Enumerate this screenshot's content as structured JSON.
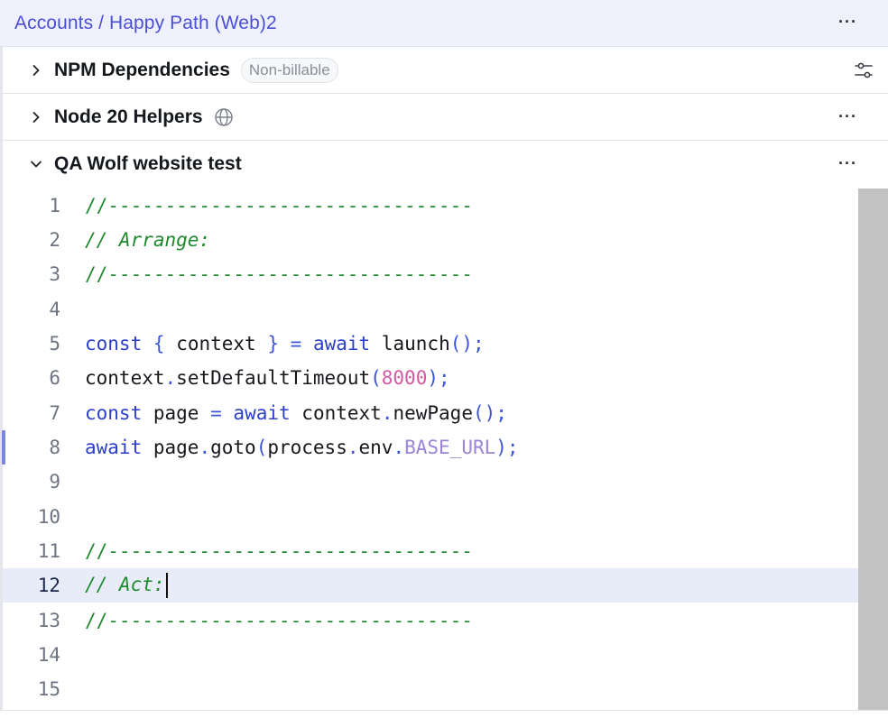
{
  "header": {
    "breadcrumb": "Accounts / Happy Path (Web)2",
    "more": "···"
  },
  "sections": [
    {
      "title": "NPM Dependencies",
      "badge": "Non-billable",
      "expanded": false,
      "icon": "filter-icon"
    },
    {
      "title": "Node 20 Helpers",
      "expanded": false,
      "icon": "globe-icon",
      "more": "···"
    },
    {
      "title": "QA Wolf website test",
      "expanded": true,
      "more": "···"
    }
  ],
  "editor": {
    "active_line": 12,
    "lines": [
      {
        "n": "1",
        "text": "//--------------------------------"
      },
      {
        "n": "2",
        "text": "// Arrange:"
      },
      {
        "n": "3",
        "text": "//--------------------------------"
      },
      {
        "n": "4",
        "text": ""
      },
      {
        "n": "5",
        "text": "const { context } = await launch();"
      },
      {
        "n": "6",
        "text": "context.setDefaultTimeout(8000);"
      },
      {
        "n": "7",
        "text": "const page = await context.newPage();"
      },
      {
        "n": "8",
        "text": "await page.goto(process.env.BASE_URL);"
      },
      {
        "n": "9",
        "text": ""
      },
      {
        "n": "10",
        "text": ""
      },
      {
        "n": "11",
        "text": "//--------------------------------"
      },
      {
        "n": "12",
        "text": "// Act:"
      },
      {
        "n": "13",
        "text": "//--------------------------------"
      },
      {
        "n": "14",
        "text": ""
      },
      {
        "n": "15",
        "text": ""
      }
    ]
  },
  "colors": {
    "accent": "#4b4fd6",
    "comment": "#1f8a2d",
    "keyword": "#2b3fc9",
    "number": "#d35aa0",
    "constant": "#9b84d6"
  }
}
